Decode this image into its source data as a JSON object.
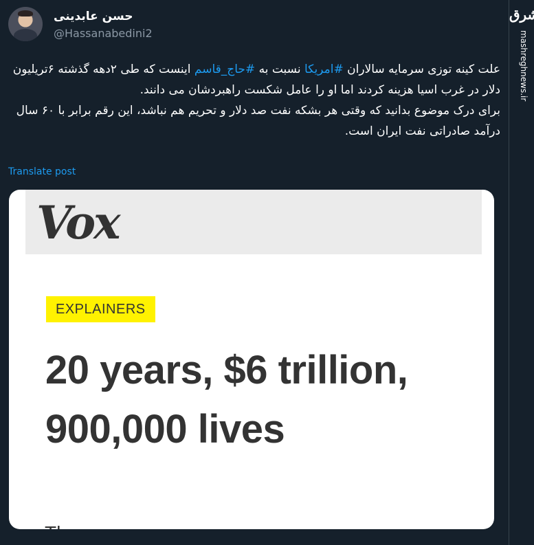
{
  "author": {
    "display_name": "حسن عابدینی",
    "handle": "@Hassanabedini2"
  },
  "tweet": {
    "line1_prefix": "علت کینه توزی سرمایه سالاران ",
    "hashtag_america": "#امریکا",
    "line1_middle": " نسبت به ",
    "hashtag_haj_qasem": "#حاج_قاسم",
    "line1_suffix": " اینست که طی ۲دهه گذشته ۶تریلیون دلار در غرب اسیا هزینه کردند اما او را عامل شکست راهبردشان می دانند.",
    "paragraph2": "برای درک موضوع بدانید که وقتی هر بشکه نفت صد دلار و تحریم هم نباشد، این رقم برابر با ۶۰ سال درآمد صادراتی نفت ایران است."
  },
  "translate_label": "Translate post",
  "media": {
    "logo": "Vox",
    "badge": "EXPLAINERS",
    "headline": "20 years, $6 trillion, 900,000 lives",
    "cut_text": "Th"
  },
  "watermark": {
    "logo_text": "مشرق",
    "site": "mashreghnews.ir"
  },
  "colors": {
    "background": "#15202b",
    "link": "#1d9bf0",
    "badge": "#fff200"
  }
}
